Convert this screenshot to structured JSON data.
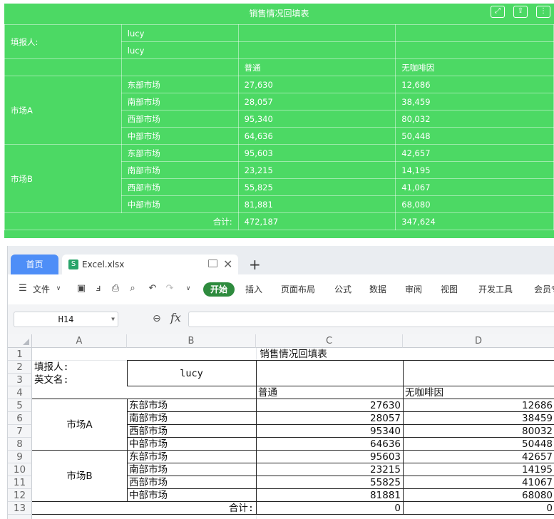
{
  "report": {
    "title": "销售情况回填表",
    "toolbar_icons": [
      "fullscreen-icon",
      "export-icon",
      "more-icon"
    ],
    "reporter_label": "填报人:",
    "reporter_values": [
      "lucy",
      "lucy"
    ],
    "columns": [
      "普通",
      "无咖啡因"
    ],
    "groups": [
      {
        "name": "市场A",
        "rows": [
          {
            "region": "东部市场",
            "normal": "27,630",
            "decaf": "12,686"
          },
          {
            "region": "南部市场",
            "normal": "28,057",
            "decaf": "38,459"
          },
          {
            "region": "西部市场",
            "normal": "95,340",
            "decaf": "80,032"
          },
          {
            "region": "中部市场",
            "normal": "64,636",
            "decaf": "50,448"
          }
        ]
      },
      {
        "name": "市场B",
        "rows": [
          {
            "region": "东部市场",
            "normal": "95,603",
            "decaf": "42,657"
          },
          {
            "region": "南部市场",
            "normal": "23,215",
            "decaf": "14,195"
          },
          {
            "region": "西部市场",
            "normal": "55,825",
            "decaf": "41,067"
          },
          {
            "region": "中部市场",
            "normal": "81,881",
            "decaf": "68,080"
          }
        ]
      }
    ],
    "total_label": "合计:",
    "total_normal": "472,187",
    "total_decaf": "347,624",
    "bg_color": "#4cd964"
  },
  "wps": {
    "tabs": {
      "home": "首页",
      "file": "Excel.xlsx",
      "new_tab": "+"
    },
    "menu": {
      "file": "文件",
      "start": "开始",
      "items": [
        "插入",
        "页面布局",
        "公式",
        "数据",
        "审阅",
        "视图",
        "开发工具",
        "会员专"
      ]
    },
    "name_box": "H14",
    "fx_label": "fx",
    "formula_value": "",
    "columns": [
      "A",
      "B",
      "C",
      "D"
    ],
    "rows": [
      "1",
      "2",
      "3",
      "4",
      "5",
      "6",
      "7",
      "8",
      "9",
      "10",
      "11",
      "12",
      "13"
    ],
    "cells": {
      "title": "销售情况回填表",
      "a2": "填报人:",
      "a3": "英文名:",
      "b23": "lucy",
      "c4": "普通",
      "d4": "无咖啡因",
      "marketA": "市场A",
      "marketB": "市场B",
      "b_regions": [
        "东部市场",
        "南部市场",
        "西部市场",
        "中部市场",
        "东部市场",
        "南部市场",
        "西部市场",
        "中部市场"
      ],
      "c_values": [
        "27630",
        "28057",
        "95340",
        "64636",
        "95603",
        "23215",
        "55825",
        "81881"
      ],
      "d_values": [
        "12686",
        "38459",
        "80032",
        "50448",
        "42657",
        "14195",
        "41067",
        "68080"
      ],
      "total_label": "合计:",
      "c13": "0",
      "d13": "0"
    },
    "accent": "#4e8ef7",
    "start_color": "#2e8b3e"
  }
}
